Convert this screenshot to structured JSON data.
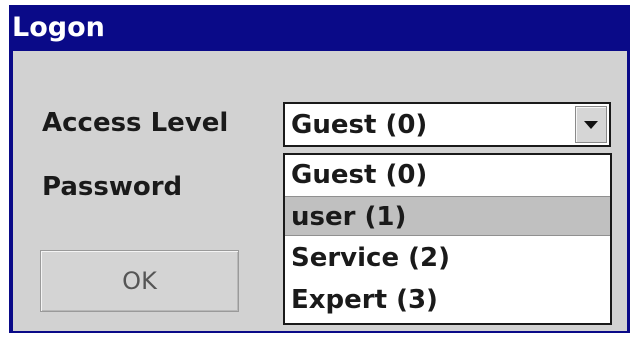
{
  "window": {
    "title": "Logon"
  },
  "form": {
    "access_level_label": "Access Level",
    "password_label": "Password",
    "ok_label": "OK"
  },
  "access_level": {
    "selected": "Guest (0)",
    "options": [
      {
        "label": "Guest (0)",
        "highlighted": false
      },
      {
        "label": "user (1)",
        "highlighted": true
      },
      {
        "label": "Service (2)",
        "highlighted": false
      },
      {
        "label": "Expert (3)",
        "highlighted": false
      }
    ]
  },
  "icons": {
    "dropdown_arrow": "chevron-down-icon"
  },
  "colors": {
    "titlebar": "#0a0a88",
    "client_background": "#d2d2d2",
    "highlight": "#c0c0c0"
  }
}
